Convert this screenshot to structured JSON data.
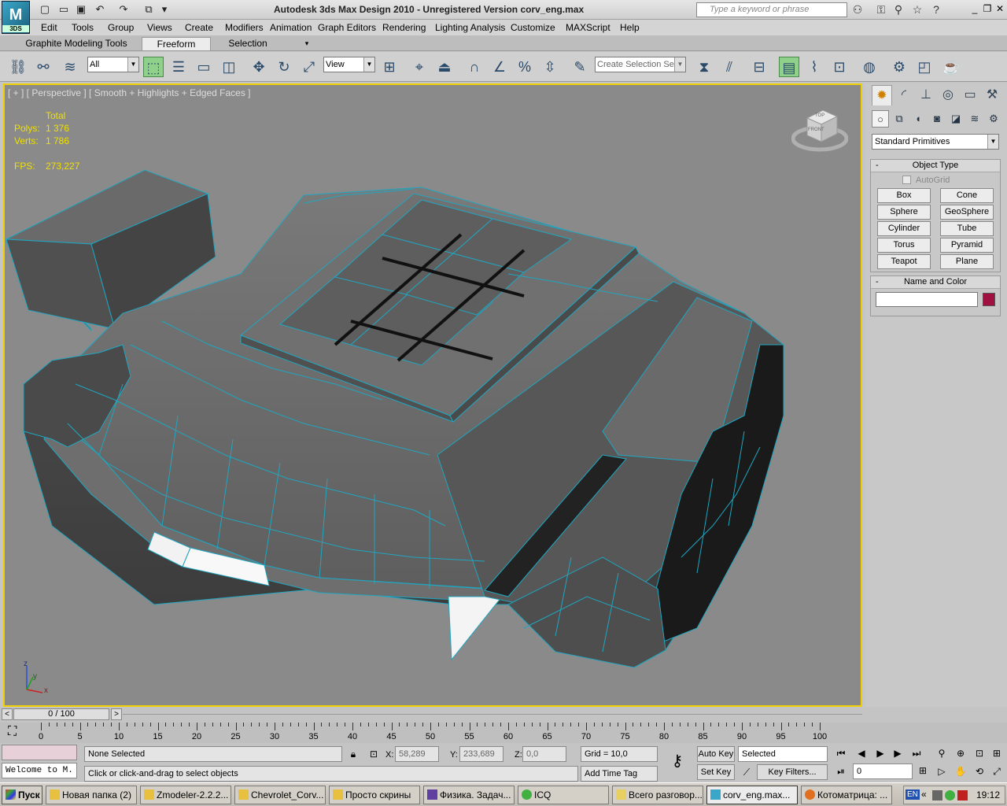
{
  "app": {
    "title": "Autodesk 3ds Max Design 2010  -  Unregistered Version     corv_eng.max",
    "logo_text": "3DS",
    "search_placeholder": "Type a keyword or phrase"
  },
  "menu": [
    "Edit",
    "Tools",
    "Group",
    "Views",
    "Create",
    "Modifiers",
    "Animation",
    "Graph Editors",
    "Rendering",
    "Lighting Analysis",
    "Customize",
    "MAXScript",
    "Help"
  ],
  "ribbon_tabs": [
    "Graphite Modeling Tools",
    "Freeform",
    "Selection"
  ],
  "toolbar": {
    "filter_value": "All",
    "refcoord_value": "View",
    "selection_set_placeholder": "Create Selection Se"
  },
  "viewport": {
    "label": "[ + ] [ Perspective ] [ Smooth + Highlights + Edged Faces ]",
    "stats": {
      "total_label": "Total",
      "polys_label": "Polys:",
      "polys_value": "1 376",
      "verts_label": "Verts:",
      "verts_value": "1 786",
      "fps_label": "FPS:",
      "fps_value": "273,227"
    },
    "viewcube_top": "TOP",
    "viewcube_front": "FRONT",
    "axis_z": "z",
    "axis_y": "y",
    "axis_x": "x"
  },
  "command_panel": {
    "category": "Standard Primitives",
    "object_type_title": "Object Type",
    "autogrid_label": "AutoGrid",
    "buttons": [
      "Box",
      "Cone",
      "Sphere",
      "GeoSphere",
      "Cylinder",
      "Tube",
      "Torus",
      "Pyramid",
      "Teapot",
      "Plane"
    ],
    "name_color_title": "Name and Color",
    "swatch_color": "#a01040"
  },
  "timeline": {
    "frame_display": "0 / 100",
    "ticks": [
      "0",
      "5",
      "10",
      "15",
      "20",
      "25",
      "30",
      "35",
      "40",
      "45",
      "50",
      "55",
      "60",
      "65",
      "70",
      "75",
      "80",
      "85",
      "90",
      "95",
      "100"
    ]
  },
  "status": {
    "maxscript_text": "Welcome to M.",
    "selection_text": "None Selected",
    "prompt_text": "Click or click-and-drag to select objects",
    "x_label": "X:",
    "x_value": "58,289",
    "y_label": "Y:",
    "y_value": "233,689",
    "z_label": "Z:",
    "z_value": "0,0",
    "grid_text": "Grid = 10,0",
    "add_time_tag": "Add Time Tag",
    "auto_key": "Auto Key",
    "set_key": "Set Key",
    "key_mode_value": "Selected",
    "key_filters": "Key Filters...",
    "frame_value": "0"
  },
  "taskbar": {
    "start": "Пуск",
    "tasks": [
      "Новая папка (2)",
      "Zmodeler-2.2.2...",
      "Chevrolet_Corv...",
      "Просто скрины",
      "Физика. Задач...",
      "ICQ",
      "Всего разговор...",
      "corv_eng.max...",
      "Котоматрица: ..."
    ],
    "lang": "EN",
    "clock": "19:12"
  }
}
